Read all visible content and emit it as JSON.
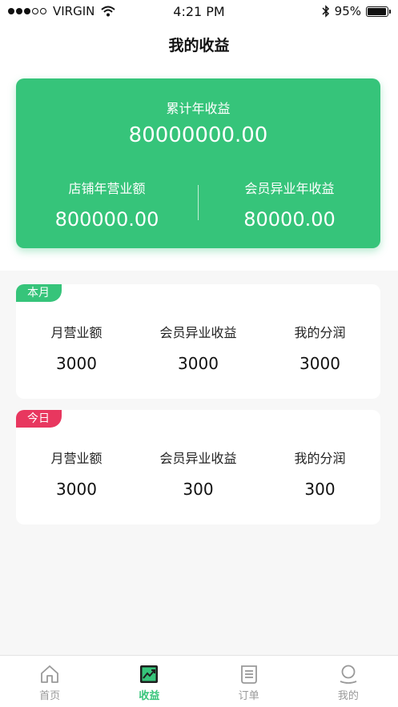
{
  "status_bar": {
    "carrier": "VIRGIN",
    "time": "4:21 PM",
    "battery": "95%"
  },
  "header": {
    "title": "我的收益"
  },
  "summary": {
    "total_label": "累计年收益",
    "total_value": "80000000.00",
    "store_label": "店铺年营业额",
    "store_value": "800000.00",
    "member_label": "会员异业年收益",
    "member_value": "80000.00"
  },
  "month_card": {
    "tag": "本月",
    "stats": [
      {
        "label": "月营业额",
        "value": "3000"
      },
      {
        "label": "会员异业收益",
        "value": "3000"
      },
      {
        "label": "我的分润",
        "value": "3000"
      }
    ]
  },
  "today_card": {
    "tag": "今日",
    "stats": [
      {
        "label": "月营业额",
        "value": "3000"
      },
      {
        "label": "会员异业收益",
        "value": "300"
      },
      {
        "label": "我的分润",
        "value": "300"
      }
    ]
  },
  "tab_bar": {
    "tabs": [
      {
        "label": "首页",
        "icon": "home-icon"
      },
      {
        "label": "收益",
        "icon": "earnings-chart-icon",
        "active": true
      },
      {
        "label": "订单",
        "icon": "order-list-icon"
      },
      {
        "label": "我的",
        "icon": "profile-icon"
      }
    ]
  },
  "colors": {
    "accent": "#36c47a",
    "today_tag": "#e8375f",
    "inactive_tab": "#999999"
  }
}
